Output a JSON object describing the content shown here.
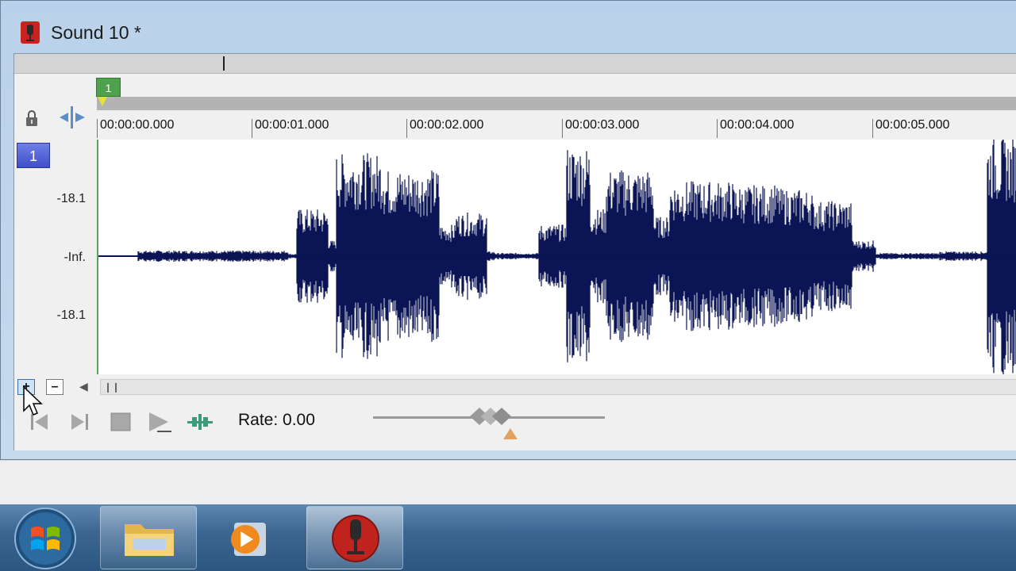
{
  "window": {
    "title": "Sound 10 *",
    "app_icon": "sound-forge-icon"
  },
  "region": {
    "marker_label": "1"
  },
  "ruler": {
    "ticks": [
      "00:00:00.000",
      "00:00:01.000",
      "00:00:02.000",
      "00:00:03.000",
      "00:00:04.000",
      "00:00:05.000"
    ]
  },
  "track": {
    "number": "1",
    "db_labels": {
      "top": "-18.1",
      "center": "-Inf.",
      "bottom": "-18.1"
    },
    "waveform_color": "#0b1454"
  },
  "controls": {
    "zoom_in_label": "+",
    "zoom_out_label": "–",
    "rate_label": "Rate: 0.00"
  },
  "taskbar": {
    "items": [
      "windows-explorer",
      "windows-media-player",
      "sound-forge"
    ]
  }
}
